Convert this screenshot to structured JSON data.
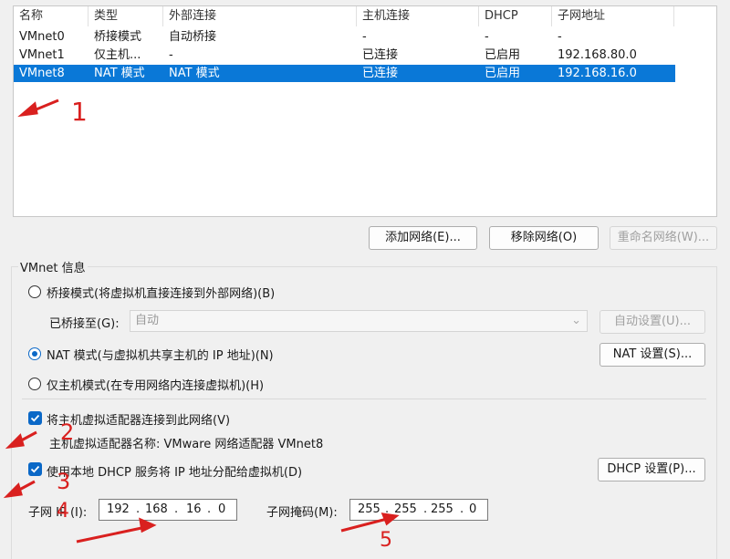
{
  "list": {
    "columns": [
      "名称",
      "类型",
      "外部连接",
      "主机连接",
      "DHCP",
      "子网地址"
    ],
    "rows": [
      [
        "VMnet0",
        "桥接模式",
        "自动桥接",
        "-",
        "-",
        "-"
      ],
      [
        "VMnet1",
        "仅主机...",
        "-",
        "已连接",
        "已启用",
        "192.168.80.0"
      ],
      [
        "VMnet8",
        "NAT 模式",
        "NAT 模式",
        "已连接",
        "已启用",
        "192.168.16.0"
      ]
    ],
    "selected_row": 2
  },
  "buttons": {
    "add_network": "添加网络(E)...",
    "remove_network": "移除网络(O)",
    "rename_network": "重命名网络(W)..."
  },
  "vmnet_info": {
    "group_label": "VMnet 信息",
    "bridge_mode": "桥接模式(将虚拟机直接连接到外部网络)(B)",
    "bridged_to_label": "已桥接至(G):",
    "bridged_to_value": "自动",
    "auto_settings": "自动设置(U)...",
    "nat_mode": "NAT 模式(与虚拟机共享主机的 IP 地址)(N)",
    "nat_settings": "NAT 设置(S)...",
    "host_only": "仅主机模式(在专用网络内连接虚拟机)(H)",
    "connect_adapter": "将主机虚拟适配器连接到此网络(V)",
    "adapter_name": "主机虚拟适配器名称: VMware 网络适配器 VMnet8",
    "use_dhcp": "使用本地 DHCP 服务将 IP 地址分配给虚拟机(D)",
    "dhcp_settings": "DHCP 设置(P)...",
    "subnet_ip_label": "子网 IP (I):",
    "subnet_ip": [
      "192",
      "168",
      "16",
      "0"
    ],
    "subnet_mask_label": "子网掩码(M):",
    "subnet_mask": [
      "255",
      "255",
      "255",
      "0"
    ]
  },
  "annotations": [
    "1",
    "2",
    "3",
    "4",
    "5"
  ],
  "colors": {
    "accent": "#0a78d7",
    "annotation": "#d9201f"
  }
}
